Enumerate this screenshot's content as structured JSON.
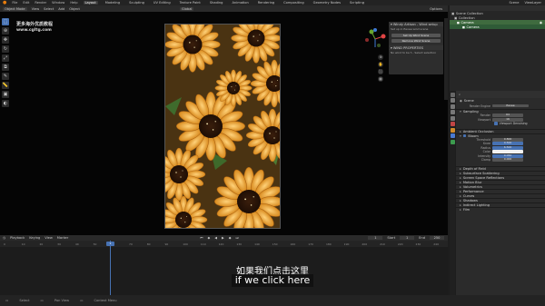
{
  "menubar": {
    "menus": [
      "File",
      "Edit",
      "Render",
      "Window",
      "Help"
    ],
    "workspaces": [
      {
        "label": "Layout",
        "active": true
      },
      {
        "label": "Modeling",
        "active": false
      },
      {
        "label": "Sculpting",
        "active": false
      },
      {
        "label": "UV Editing",
        "active": false
      },
      {
        "label": "Texture Paint",
        "active": false
      },
      {
        "label": "Shading",
        "active": false
      },
      {
        "label": "Animation",
        "active": false
      },
      {
        "label": "Rendering",
        "active": false
      },
      {
        "label": "Compositing",
        "active": false
      },
      {
        "label": "Geometry Nodes",
        "active": false
      },
      {
        "label": "Scripting",
        "active": false
      }
    ],
    "scene": "Scene",
    "view_layer": "ViewLayer"
  },
  "viewport_header": {
    "mode": "Object Mode",
    "items": [
      "View",
      "Select",
      "Add",
      "Object"
    ],
    "orientation": "Global",
    "options": "Options"
  },
  "watermark": {
    "line1": "更多海外优质教程",
    "line2": "www.cgltg.com"
  },
  "addon_panel": {
    "title": "Windy Artisan - Wind setup",
    "desc1": "Set up in Eevee wind scene",
    "btn1": "Set Up Wind Scene",
    "btn2": "Remove Wind Scene",
    "section2": "WIND PROPERTIES",
    "desc2": "No wind to be f... Select selection"
  },
  "outliner": {
    "rows": [
      {
        "label": "Scene Collection",
        "cls": ""
      },
      {
        "label": "Collection",
        "cls": ""
      },
      {
        "label": "Camera",
        "cls": "sel"
      },
      {
        "label": "Camera",
        "cls": "hi"
      }
    ]
  },
  "properties": {
    "scene_label": "Scene",
    "render_engine_label": "Render Engine",
    "render_engine_value": "Eevee",
    "sampling": "Sampling",
    "render_label": "Render",
    "render_value": "64",
    "viewport_label": "Viewport",
    "viewport_value": "16",
    "denoise_label": "Viewport Denoising",
    "ao": "Ambient Occlusion",
    "bloom": "Bloom",
    "threshold_label": "Threshold",
    "threshold_value": "0.800",
    "knee_label": "Knee",
    "knee_value": "0.500",
    "radius_label": "Radius",
    "radius_value": "6.500",
    "color_label": "Color",
    "intensity_label": "Intensity",
    "intensity_value": "0.050",
    "clamp_label": "Clamp",
    "clamp_value": "0.000",
    "sections": [
      "Depth of Field",
      "Subsurface Scattering",
      "Screen Space Reflections",
      "Motion Blur",
      "Volumetrics",
      "Performance",
      "Curves",
      "Shadows",
      "Indirect Lighting",
      "Film"
    ]
  },
  "timeline": {
    "items": [
      "Playback",
      "Keying",
      "View",
      "Marker"
    ],
    "current_frame": "1",
    "start_label": "Start",
    "start_value": "1",
    "end_label": "End",
    "end_value": "250",
    "ticks": [
      "0",
      "10",
      "20",
      "30",
      "40",
      "50",
      "60",
      "70",
      "80",
      "90",
      "100",
      "110",
      "120",
      "130",
      "140",
      "150",
      "160",
      "170",
      "180",
      "190",
      "200",
      "210",
      "220",
      "230",
      "240"
    ]
  },
  "subtitles": {
    "zh": "如果我们点击这里",
    "en": "if we click here"
  },
  "statusbar": {
    "items": [
      "Select",
      "Pan View",
      "Context Menu"
    ]
  },
  "colors": {
    "accent": "#4772b3",
    "outliner_selected": "#3f6b3f"
  }
}
